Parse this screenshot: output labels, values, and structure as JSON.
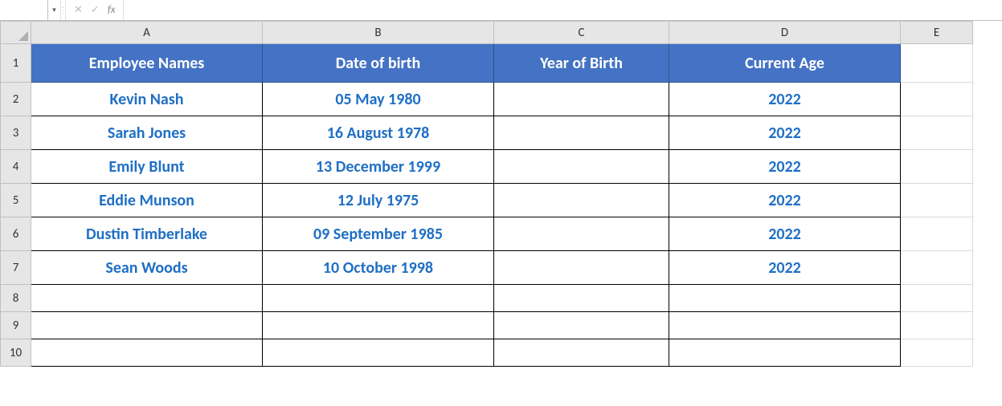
{
  "formula_bar": {
    "name_box": "",
    "fx_label": "fx",
    "input_value": ""
  },
  "columns": [
    "A",
    "B",
    "C",
    "D",
    "E"
  ],
  "row_numbers": [
    "1",
    "2",
    "3",
    "4",
    "5",
    "6",
    "7",
    "8",
    "9",
    "10"
  ],
  "headers": {
    "A": "Employee Names",
    "B": "Date of birth",
    "C": "Year of Birth",
    "D": "Current Age"
  },
  "rows": [
    {
      "A": "Kevin Nash",
      "B": "05 May 1980",
      "C": "",
      "D": "2022"
    },
    {
      "A": "Sarah Jones",
      "B": "16 August 1978",
      "C": "",
      "D": "2022"
    },
    {
      "A": "Emily Blunt",
      "B": "13 December 1999",
      "C": "",
      "D": "2022"
    },
    {
      "A": "Eddie Munson",
      "B": "12 July 1975",
      "C": "",
      "D": "2022"
    },
    {
      "A": "Dustin Timberlake",
      "B": "09 September 1985",
      "C": "",
      "D": "2022"
    },
    {
      "A": "Sean Woods",
      "B": "10 October 1998",
      "C": "",
      "D": "2022"
    }
  ],
  "colors": {
    "header_bg": "#4472C4",
    "data_text": "#1F6FC5"
  },
  "chart_data": {
    "type": "table",
    "title": "",
    "columns": [
      "Employee Names",
      "Date of birth",
      "Year of Birth",
      "Current Age"
    ],
    "data": [
      [
        "Kevin Nash",
        "05 May 1980",
        "",
        "2022"
      ],
      [
        "Sarah Jones",
        "16 August 1978",
        "",
        "2022"
      ],
      [
        "Emily Blunt",
        "13 December 1999",
        "",
        "2022"
      ],
      [
        "Eddie Munson",
        "12 July 1975",
        "",
        "2022"
      ],
      [
        "Dustin Timberlake",
        "09 September 1985",
        "",
        "2022"
      ],
      [
        "Sean Woods",
        "10 October 1998",
        "",
        "2022"
      ]
    ]
  }
}
